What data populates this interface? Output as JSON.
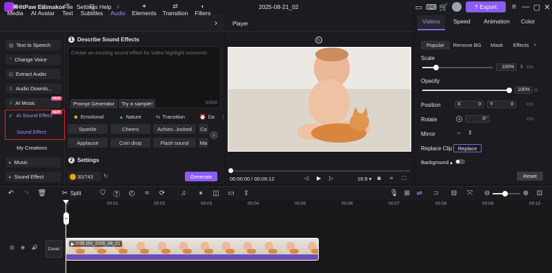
{
  "titlebar": {
    "app_name": "HitPaw Edimakor",
    "menu": [
      "File",
      "Settings",
      "Help"
    ],
    "project_name": "2025-08-21_02",
    "export_label": "Export"
  },
  "toolbar_tabs": [
    {
      "label": "Media",
      "icon": "media-icon"
    },
    {
      "label": "AI Avatar",
      "icon": "avatar-icon"
    },
    {
      "label": "Text",
      "icon": "text-icon"
    },
    {
      "label": "Subtitles",
      "icon": "subtitles-icon"
    },
    {
      "label": "Audio",
      "icon": "music-note-icon"
    },
    {
      "label": "Elements",
      "icon": "elements-icon"
    },
    {
      "label": "Transition",
      "icon": "transition-icon"
    },
    {
      "label": "Filters",
      "icon": "filters-icon"
    }
  ],
  "sidebar": {
    "items": [
      {
        "label": "Text to Speech"
      },
      {
        "label": "Change Voice"
      },
      {
        "label": "Extract Audio"
      },
      {
        "label": "Audio Downlo..."
      },
      {
        "label": "AI Music",
        "badge": "NEW"
      },
      {
        "label": "AI Sound Effect",
        "badge": "NEW"
      },
      {
        "label": "Sound Effect"
      },
      {
        "label": "My Creations"
      },
      {
        "label": "Music"
      },
      {
        "label": "Sound Effect"
      }
    ]
  },
  "sound_panel": {
    "section1_num": "1",
    "section1_title": "Describe Sound Effects",
    "placeholder": "Create an exciting sound effect for video highlight moments",
    "prompt_generator": "Prompt Generator",
    "try_sample": "Try a sample!",
    "counter": "0/400",
    "categories": [
      "Emotional",
      "Nature",
      "Transition",
      "Da"
    ],
    "chips_row1": [
      "Sparkle",
      "Cheers",
      "Achiev...locked",
      "Co"
    ],
    "chips_row2": [
      "Applause",
      "Coin drop",
      "Flash sound",
      "Ma"
    ],
    "section2_num": "2",
    "section2_title": "Settings",
    "credits": "30/743",
    "generate_label": "Generate"
  },
  "player": {
    "title": "Player",
    "time_current": "00:00:00",
    "time_sep": " / ",
    "time_total": "00:05:12",
    "aspect": "16:9"
  },
  "properties": {
    "tabs": [
      "Videos",
      "Speed",
      "Animation",
      "Color"
    ],
    "subtabs": [
      "Popular",
      "Remove BG",
      "Mask",
      "Effects"
    ],
    "scale_label": "Scale",
    "scale_value": "100%",
    "opacity_label": "Opacity",
    "opacity_value": "100%",
    "position_label": "Position",
    "pos_x_label": "X",
    "pos_x": "0",
    "pos_y_label": "Y",
    "pos_y": "0",
    "rotate_label": "Rotate",
    "rotate_value": "0°",
    "mirror_label": "Mirror",
    "replace_clip_label": "Replace Clip",
    "replace_btn": "Replace",
    "background_label": "Background",
    "reset_label": "Reset"
  },
  "timeline": {
    "split_label": "Split",
    "ruler_ticks": [
      "0",
      "00:01",
      "00:02",
      "00:03",
      "00:04",
      "00:05",
      "00:06",
      "00:07",
      "00:08",
      "00:09",
      "00:10"
    ],
    "cover_label": "Cover",
    "clip_label": "0:05 I2V_2025_08_21"
  },
  "colors": {
    "accent": "#8b5cf6",
    "highlight_border": "#dc2626"
  }
}
